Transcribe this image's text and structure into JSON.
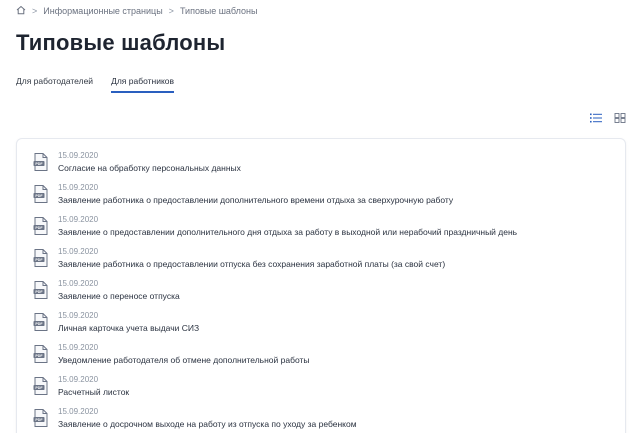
{
  "breadcrumb": {
    "items": [
      "Информационные страницы",
      "Типовые шаблоны"
    ],
    "separator": ">"
  },
  "page": {
    "title": "Типовые шаблоны"
  },
  "tabs": [
    {
      "label": "Для работодателей",
      "active": false
    },
    {
      "label": "Для работников",
      "active": true
    }
  ],
  "view_toggles": {
    "list_icon": "list-view-icon",
    "grid_icon": "grid-view-icon",
    "active": "list"
  },
  "colors": {
    "accent": "#2a5fbf",
    "icon": "#6b7486"
  },
  "documents": [
    {
      "date": "15.09.2020",
      "title": "Согласие на обработку персональных данных",
      "icon": "pdf-icon"
    },
    {
      "date": "15.09.2020",
      "title": "Заявление работника о предоставлении дополнительного времени отдыха за сверхурочную работу",
      "icon": "pdf-icon"
    },
    {
      "date": "15.09.2020",
      "title": "Заявление о предоставлении дополнительного дня отдыха за работу в выходной или нерабочий праздничный день",
      "icon": "pdf-icon"
    },
    {
      "date": "15.09.2020",
      "title": "Заявление работника о предоставлении отпуска без сохранения заработной платы (за свой счет)",
      "icon": "pdf-icon"
    },
    {
      "date": "15.09.2020",
      "title": "Заявление о переносе отпуска",
      "icon": "pdf-icon"
    },
    {
      "date": "15.09.2020",
      "title": "Личная карточка учета выдачи СИЗ",
      "icon": "pdf-icon"
    },
    {
      "date": "15.09.2020",
      "title": "Уведомление работодателя об отмене дополнительной работы",
      "icon": "pdf-icon"
    },
    {
      "date": "15.09.2020",
      "title": "Расчетный листок",
      "icon": "pdf-icon"
    },
    {
      "date": "15.09.2020",
      "title": "Заявление о досрочном выходе на работу из отпуска по уходу за ребенком",
      "icon": "pdf-icon"
    }
  ]
}
